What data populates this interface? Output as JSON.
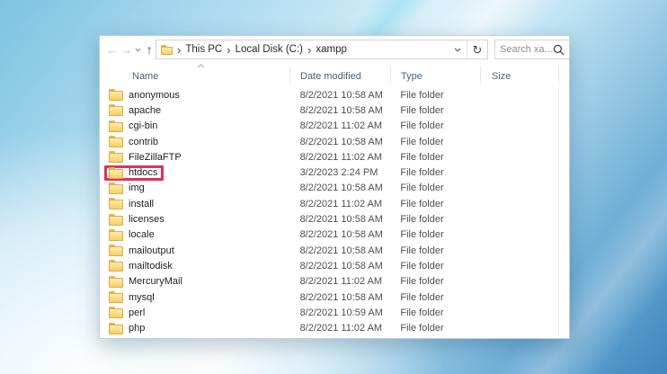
{
  "background": {
    "style": "light-blue abstract swoosh wallpaper",
    "colors": {
      "top_left": "#7ec2e2",
      "center_light": "#d7eef9",
      "bottom_right": "#3e88bc",
      "streak": "#ffffff"
    }
  },
  "explorer": {
    "toolbar": {
      "nav": {
        "back_icon": "←",
        "forward_icon": "→",
        "recent_dropdown_icon": "chevron-down",
        "up_icon": "↑"
      },
      "breadcrumb": {
        "segments": [
          "This PC",
          "Local Disk (C:)",
          "xampp"
        ],
        "separator": "›"
      },
      "address_dropdown_icon": "chevron-down",
      "refresh_icon": "↻",
      "search": {
        "placeholder": "Search xa...",
        "icon": "magnifier"
      }
    },
    "columns": {
      "name": "Name",
      "date_modified": "Date modified",
      "type": "Type",
      "size": "Size",
      "sort_indicator": "ascending-on-name"
    },
    "files": [
      {
        "name": "anonymous",
        "date_modified": "8/2/2021 10:58 AM",
        "type": "File folder",
        "size": ""
      },
      {
        "name": "apache",
        "date_modified": "8/2/2021 10:58 AM",
        "type": "File folder",
        "size": ""
      },
      {
        "name": "cgi-bin",
        "date_modified": "8/2/2021 11:02 AM",
        "type": "File folder",
        "size": ""
      },
      {
        "name": "contrib",
        "date_modified": "8/2/2021 10:58 AM",
        "type": "File folder",
        "size": ""
      },
      {
        "name": "FileZillaFTP",
        "date_modified": "8/2/2021 11:02 AM",
        "type": "File folder",
        "size": ""
      },
      {
        "name": "htdocs",
        "date_modified": "3/2/2023 2:24 PM",
        "type": "File folder",
        "size": ""
      },
      {
        "name": "img",
        "date_modified": "8/2/2021 10:58 AM",
        "type": "File folder",
        "size": ""
      },
      {
        "name": "install",
        "date_modified": "8/2/2021 11:02 AM",
        "type": "File folder",
        "size": ""
      },
      {
        "name": "licenses",
        "date_modified": "8/2/2021 10:58 AM",
        "type": "File folder",
        "size": ""
      },
      {
        "name": "locale",
        "date_modified": "8/2/2021 10:58 AM",
        "type": "File folder",
        "size": ""
      },
      {
        "name": "mailoutput",
        "date_modified": "8/2/2021 10:58 AM",
        "type": "File folder",
        "size": ""
      },
      {
        "name": "mailtodisk",
        "date_modified": "8/2/2021 10:58 AM",
        "type": "File folder",
        "size": ""
      },
      {
        "name": "MercuryMail",
        "date_modified": "8/2/2021 11:02 AM",
        "type": "File folder",
        "size": ""
      },
      {
        "name": "mysql",
        "date_modified": "8/2/2021 10:58 AM",
        "type": "File folder",
        "size": ""
      },
      {
        "name": "perl",
        "date_modified": "8/2/2021 10:59 AM",
        "type": "File folder",
        "size": ""
      },
      {
        "name": "php",
        "date_modified": "8/2/2021 11:02 AM",
        "type": "File folder",
        "size": ""
      }
    ],
    "highlight": {
      "file": "htdocs",
      "color": "#e0315b",
      "shape": "red-rectangle-annotation"
    },
    "folder_icon_color": "#f6cf68"
  }
}
